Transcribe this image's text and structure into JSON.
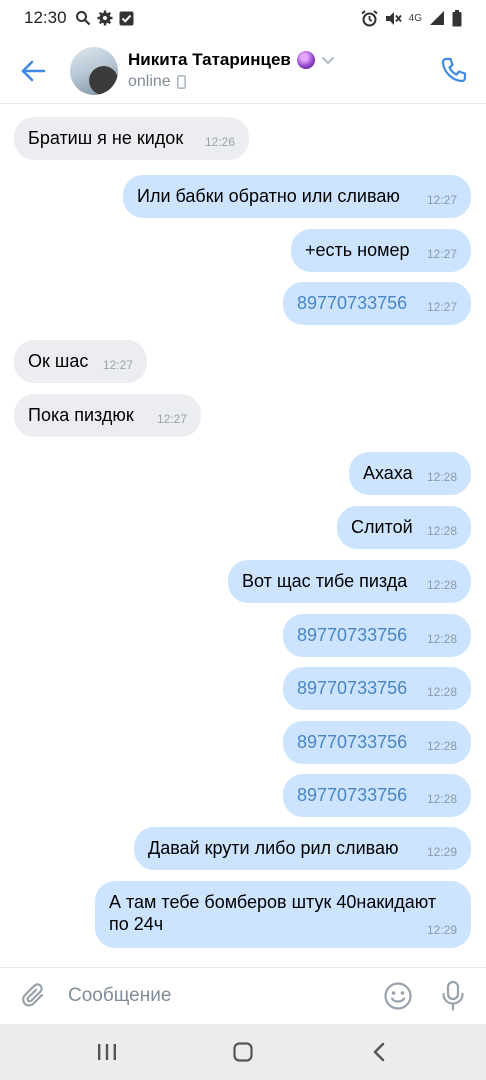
{
  "status_bar": {
    "time": "12:30",
    "network": "4G"
  },
  "header": {
    "contact_name": "Никита Татаринцев",
    "contact_status": "online",
    "accent_color": "#3f8ae0"
  },
  "messages": [
    {
      "dir": "in",
      "text": "Братиш я не кидок",
      "time": "12:26"
    },
    {
      "dir": "out",
      "text": "Или бабки обратно или сливаю",
      "time": "12:27"
    },
    {
      "dir": "out",
      "text": "+есть номер",
      "time": "12:27"
    },
    {
      "dir": "out",
      "text": "89770733756",
      "time": "12:27",
      "link": true
    },
    {
      "dir": "in",
      "text": "Ок шас",
      "time": "12:27"
    },
    {
      "dir": "in",
      "text": "Пока пиздюк",
      "time": "12:27"
    },
    {
      "dir": "out",
      "text": "Ахаха",
      "time": "12:28"
    },
    {
      "dir": "out",
      "text": "Слитой",
      "time": "12:28"
    },
    {
      "dir": "out",
      "text": "Вот щас тибе пизда",
      "time": "12:28"
    },
    {
      "dir": "out",
      "text": "89770733756",
      "time": "12:28",
      "link": true
    },
    {
      "dir": "out",
      "text": "89770733756",
      "time": "12:28",
      "link": true
    },
    {
      "dir": "out",
      "text": "89770733756",
      "time": "12:28",
      "link": true
    },
    {
      "dir": "out",
      "text": "89770733756",
      "time": "12:28",
      "link": true
    },
    {
      "dir": "out",
      "text": "Давай крути либо рил сливаю",
      "time": "12:29"
    },
    {
      "dir": "out",
      "text": "А там тебе бомберов штук 40накидают по 24ч",
      "time": "12:29"
    }
  ],
  "composer": {
    "placeholder": "Сообщение"
  },
  "icons": [
    "back-arrow-icon",
    "phone-icon",
    "paperclip-icon",
    "emoji-icon",
    "microphone-icon",
    "recents-icon",
    "home-icon",
    "back-icon"
  ]
}
